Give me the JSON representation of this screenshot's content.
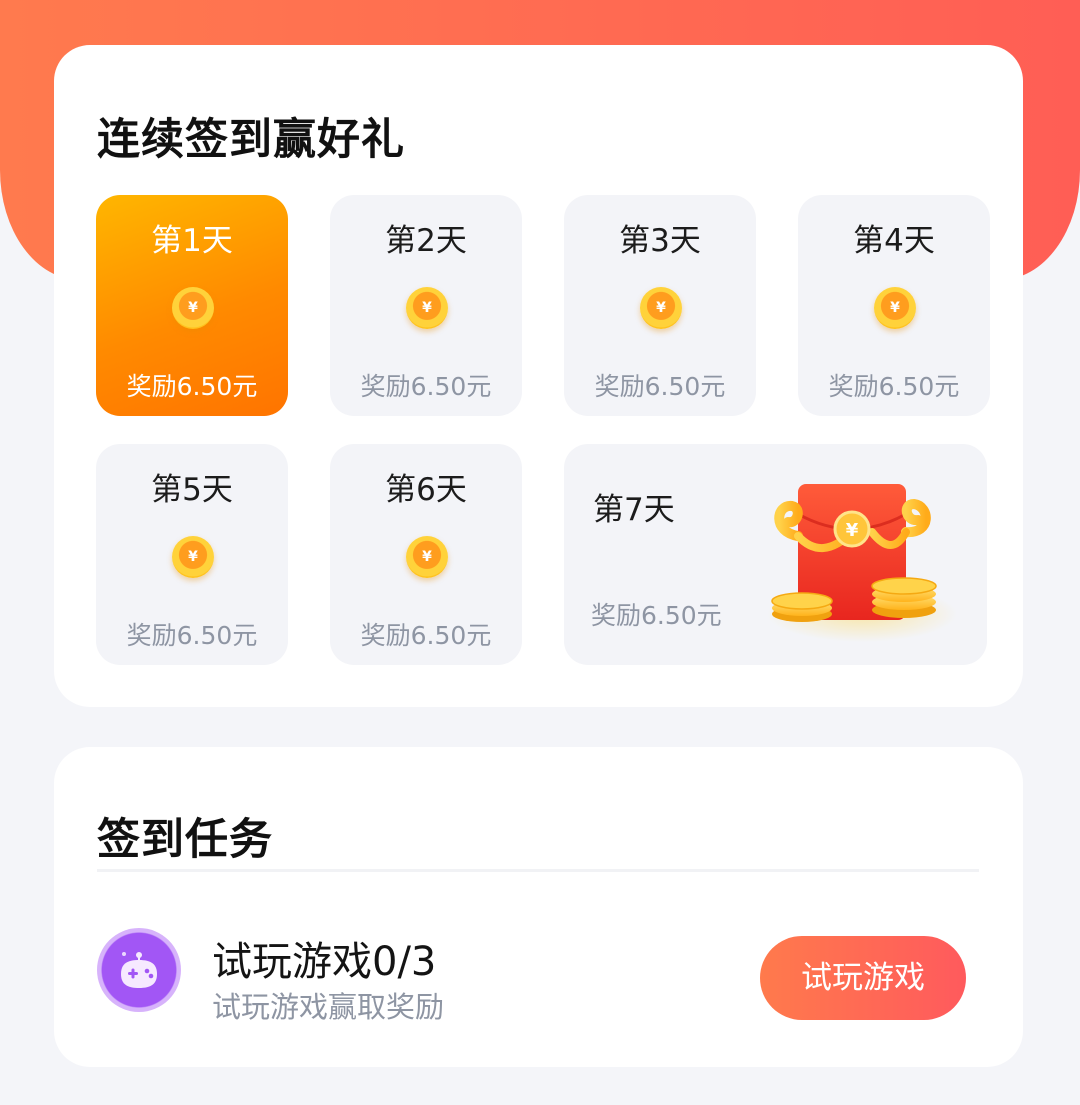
{
  "colors": {
    "header_gradient": [
      "#ff7a4e",
      "#ff5e55"
    ],
    "active_day_gradient": [
      "#ffb600",
      "#ff7400"
    ],
    "button_gradient": [
      "#ff7a4c",
      "#ff5a5d"
    ],
    "muted_text": "#8e95a3"
  },
  "checkin": {
    "title": "连续签到赢好礼",
    "days": [
      {
        "label": "第1天",
        "reward": "奖励6.50元",
        "icon": "coin-icon",
        "coin_symbol": "¥",
        "active": true
      },
      {
        "label": "第2天",
        "reward": "奖励6.50元",
        "icon": "coin-icon",
        "coin_symbol": "¥",
        "active": false
      },
      {
        "label": "第3天",
        "reward": "奖励6.50元",
        "icon": "coin-icon",
        "coin_symbol": "¥",
        "active": false
      },
      {
        "label": "第4天",
        "reward": "奖励6.50元",
        "icon": "coin-icon",
        "coin_symbol": "¥",
        "active": false
      },
      {
        "label": "第5天",
        "reward": "奖励6.50元",
        "icon": "coin-icon",
        "coin_symbol": "¥",
        "active": false
      },
      {
        "label": "第6天",
        "reward": "奖励6.50元",
        "icon": "coin-icon",
        "coin_symbol": "¥",
        "active": false
      },
      {
        "label": "第7天",
        "reward": "奖励6.50元",
        "icon": "red-envelope-icon",
        "coin_symbol": "¥",
        "active": false
      }
    ]
  },
  "tasks": {
    "title": "签到任务",
    "items": [
      {
        "icon": "gamepad-icon",
        "title": "试玩游戏0/3",
        "subtitle": "试玩游戏赢取奖励",
        "button_label": "试玩游戏"
      }
    ]
  }
}
